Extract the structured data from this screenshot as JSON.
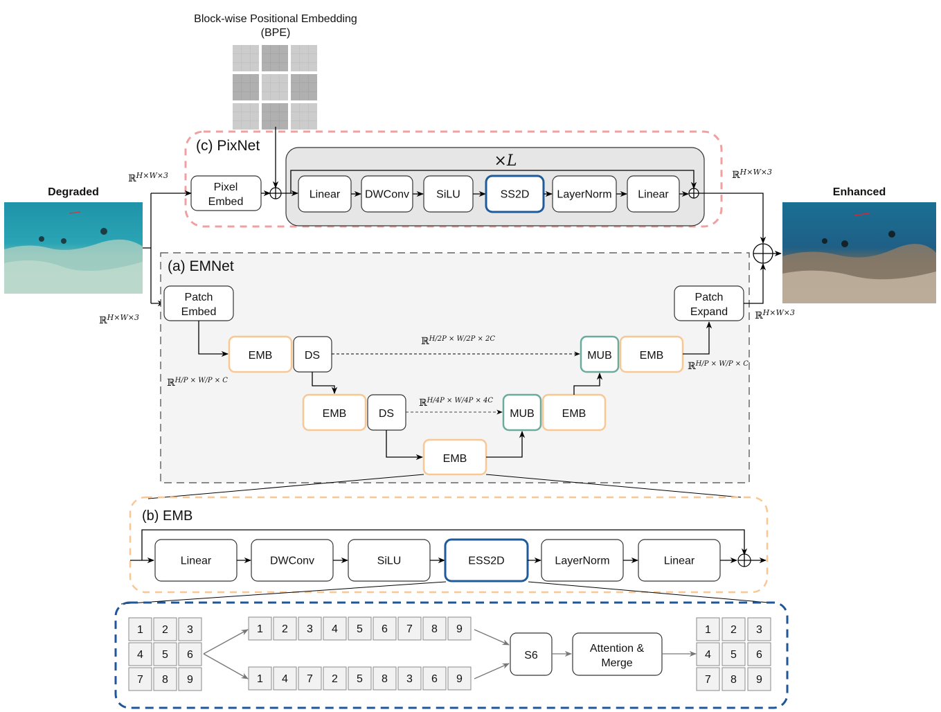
{
  "bpe": {
    "title_line1": "Block-wise Positional Embedding",
    "title_line2": "(BPE)",
    "block_shades": [
      "light",
      "dark",
      "light",
      "dark",
      "light",
      "dark",
      "light",
      "dark",
      "light"
    ]
  },
  "input_image": {
    "label": "Degraded"
  },
  "output_image": {
    "label": "Enhanced"
  },
  "shapes": {
    "input_pixnet": "H×W×3",
    "input_emnet": "H×W×3",
    "output_pixnet": "H×W×3",
    "output_emnet": "H×W×3",
    "level1_left": "H/P × W/P × C",
    "level1_right": "H/P × W/P × C",
    "skip_level2": "H/2P × W/2P × 2C",
    "skip_level3": "H/4P × W/4P × 4C"
  },
  "pixnet": {
    "title": "(c) PixNet",
    "embed_line1": "Pixel",
    "embed_line2": "Embed",
    "repeat_label": "×L",
    "blocks": [
      "Linear",
      "DWConv",
      "SiLU",
      "SS2D",
      "LayerNorm",
      "Linear"
    ],
    "highlight_index": 3
  },
  "emnet": {
    "title": "(a) EMNet",
    "patch_embed_line1": "Patch",
    "patch_embed_line2": "Embed",
    "patch_expand_line1": "Patch",
    "patch_expand_line2": "Expand",
    "emb": "EMB",
    "ds": "DS",
    "mub": "MUB"
  },
  "emb_detail": {
    "title": "(b) EMB",
    "blocks": [
      "Linear",
      "DWConv",
      "SiLU",
      "ESS2D",
      "LayerNorm",
      "Linear"
    ],
    "highlight_index": 3
  },
  "ess2d_detail": {
    "input_grid": [
      "1",
      "2",
      "3",
      "4",
      "5",
      "6",
      "7",
      "8",
      "9"
    ],
    "scan_row_major": [
      "1",
      "2",
      "3",
      "4",
      "5",
      "6",
      "7",
      "8",
      "9"
    ],
    "scan_col_major": [
      "1",
      "4",
      "7",
      "2",
      "5",
      "8",
      "3",
      "6",
      "9"
    ],
    "s6": "S6",
    "merge_line1": "Attention &",
    "merge_line2": "Merge",
    "output_grid": [
      "1",
      "2",
      "3",
      "4",
      "5",
      "6",
      "7",
      "8",
      "9"
    ]
  },
  "colors": {
    "pixnet_border": "#f0a0a0",
    "emb_border": "#f9c794",
    "mub_border": "#6aab9c",
    "ss2d_border": "#1f5a9a",
    "ess2d_frame": "#1f5599",
    "emnet_bg": "#f4f4f4",
    "pixnet_inner_bg": "#e6e6e6"
  }
}
